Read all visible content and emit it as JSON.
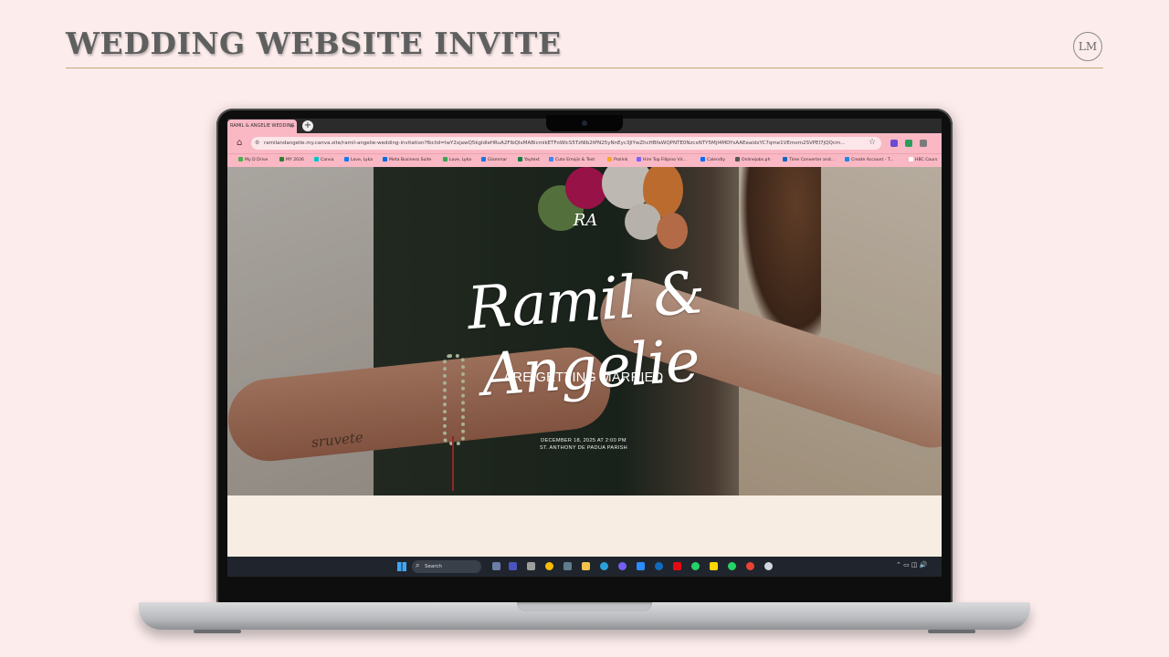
{
  "slide": {
    "title": "WEDDING WEBSITE INVITE",
    "logo_text": "LM"
  },
  "browser": {
    "tab_title": "RAMIL & ANGELIE WEDDING",
    "tab_close": "×",
    "new_tab": "+",
    "url": "ramilandangelie.my.canva.site/ramil-angelie-wedding-invitation?fbclid=IwY2xjawQ5kgldleHRuA2FlbQIxMABicmlkETFoWlcS5TzNlb2tPN25yNnEyc3JlYwZhcHBfaWQPNTE0NzcxNTY5MjI4MDYsAAEeaidxYC7qme1VEmom2SVPEI7jQQcm..."
  },
  "bookmarks": [
    {
      "label": "My D Drive",
      "color": "#4caf50"
    },
    {
      "label": "MY 2026",
      "color": "#2e7d32"
    },
    {
      "label": "Canva",
      "color": "#00c4cc"
    },
    {
      "label": "Love, Lyka",
      "color": "#1877f2"
    },
    {
      "label": "Meta Business Suite",
      "color": "#0668e1"
    },
    {
      "label": "Love, Lyka",
      "color": "#34a853"
    },
    {
      "label": "Glammar",
      "color": "#1a73e8"
    },
    {
      "label": "Yaytext",
      "color": "#0b8043"
    },
    {
      "label": "Cute Emojis & Text",
      "color": "#4285f4"
    },
    {
      "label": "Prolink",
      "color": "#f9a825"
    },
    {
      "label": "Hire Top Filipino Vir...",
      "color": "#7b61ff"
    },
    {
      "label": "Calendly",
      "color": "#006bff"
    },
    {
      "label": "Onlinejobs.ph",
      "color": "#555555"
    },
    {
      "label": "Time Converter and...",
      "color": "#1565c0"
    },
    {
      "label": "Create Account - T...",
      "color": "#1e88e5"
    },
    {
      "label": "HBC Cours",
      "color": "#ffffff"
    }
  ],
  "invite": {
    "monogram": "RA",
    "names": "Ramil & Angelie",
    "headline": "ARE GETTING MARRIED",
    "date_line": "DECEMBER 18, 2025 AT 2:00 PM",
    "venue_line": "ST. ANTHONY DE PADUA PARISH",
    "tattoo": "sruvete"
  },
  "taskbar": {
    "search_placeholder": "Search"
  },
  "colors": {
    "page_bg": "#fcecec",
    "title_rule": "#c9a77c",
    "browser_chrome": "#f9b8c4",
    "cream": "#f7ede3",
    "taskbar": "#20252d"
  }
}
